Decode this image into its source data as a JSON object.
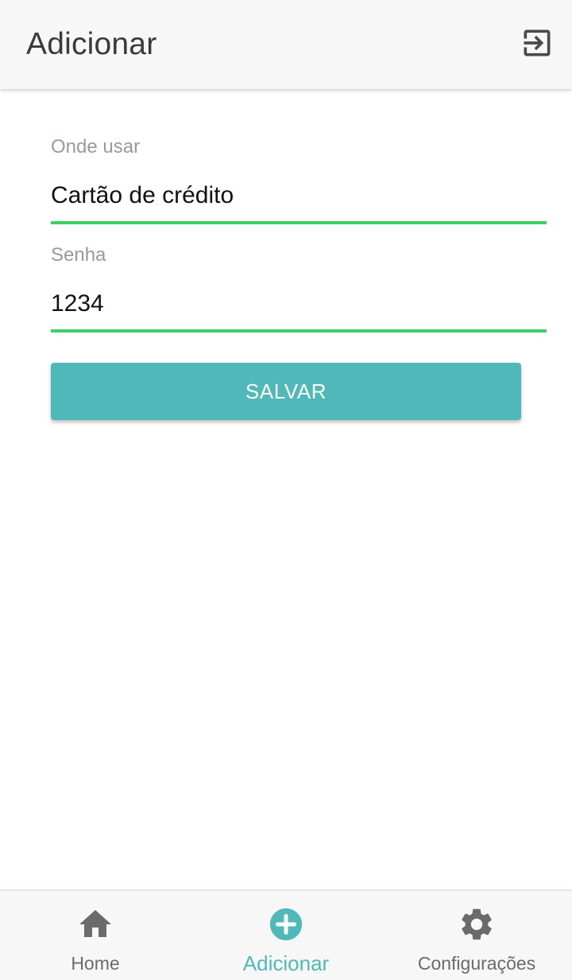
{
  "header": {
    "title": "Adicionar",
    "logout_icon": "logout-icon"
  },
  "form": {
    "where_label": "Onde usar",
    "where_value": "Cartão de crédito",
    "password_label": "Senha",
    "password_value": "1234",
    "save_label": "SALVAR"
  },
  "bottom_nav": {
    "items": [
      {
        "label": "Home",
        "icon": "home-icon",
        "active": false
      },
      {
        "label": "Adicionar",
        "icon": "add-circle-icon",
        "active": true
      },
      {
        "label": "Configurações",
        "icon": "gear-icon",
        "active": false
      }
    ]
  },
  "colors": {
    "accent": "#4fb9b9",
    "input_underline": "#3fcf6a",
    "header_bg": "#f7f7f7",
    "icon_gray": "#6b6b6b"
  }
}
